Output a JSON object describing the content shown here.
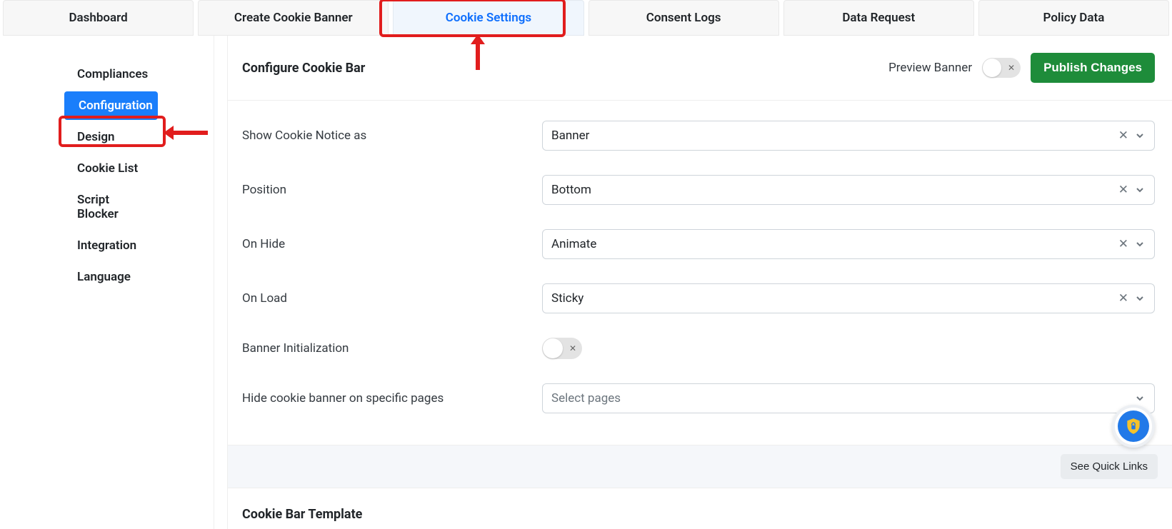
{
  "tabs": [
    {
      "label": "Dashboard"
    },
    {
      "label": "Create Cookie Banner"
    },
    {
      "label": "Cookie Settings",
      "active": true
    },
    {
      "label": "Consent Logs"
    },
    {
      "label": "Data Request"
    },
    {
      "label": "Policy Data"
    }
  ],
  "sidebar": {
    "items": [
      {
        "label": "Compliances"
      },
      {
        "label": "Configuration",
        "active": true
      },
      {
        "label": "Design"
      },
      {
        "label": "Cookie List"
      },
      {
        "label": "Script Blocker"
      },
      {
        "label": "Integration"
      },
      {
        "label": "Language"
      }
    ]
  },
  "header": {
    "title": "Configure Cookie Bar",
    "preview_label": "Preview Banner",
    "publish_label": "Publish Changes"
  },
  "form": {
    "show_as": {
      "label": "Show Cookie Notice as",
      "value": "Banner"
    },
    "position": {
      "label": "Position",
      "value": "Bottom"
    },
    "on_hide": {
      "label": "On Hide",
      "value": "Animate"
    },
    "on_load": {
      "label": "On Load",
      "value": "Sticky"
    },
    "init": {
      "label": "Banner Initialization"
    },
    "hide_pages": {
      "label": "Hide cookie banner on specific pages",
      "placeholder": "Select pages"
    }
  },
  "quicklinks": {
    "label": "See Quick Links"
  },
  "section2": {
    "title": "Cookie Bar Template"
  },
  "annotations": {
    "tab_highlight_index": 2,
    "sidebar_highlight_index": 1
  }
}
